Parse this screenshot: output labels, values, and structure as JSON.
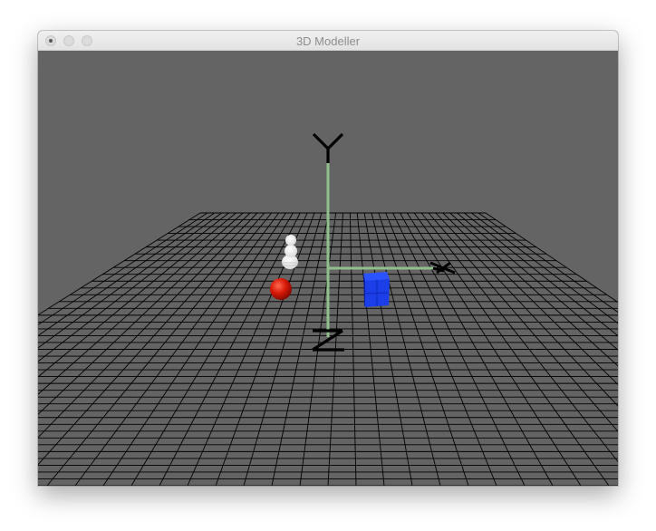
{
  "window": {
    "title": "3D Modeller"
  },
  "scene": {
    "background_color": "#646464",
    "grid_color": "#000000",
    "axis_color": "#8fbf8a",
    "axes": [
      "Y",
      "Z",
      "X"
    ],
    "objects": [
      {
        "type": "snowman",
        "color": "#ffffff"
      },
      {
        "type": "sphere",
        "color": "#dd2010"
      },
      {
        "type": "cube",
        "color": "#1a3ee8"
      }
    ]
  },
  "icons": {
    "close": "close-dot-icon",
    "minimize": "minimize-icon",
    "zoom": "zoom-icon"
  }
}
